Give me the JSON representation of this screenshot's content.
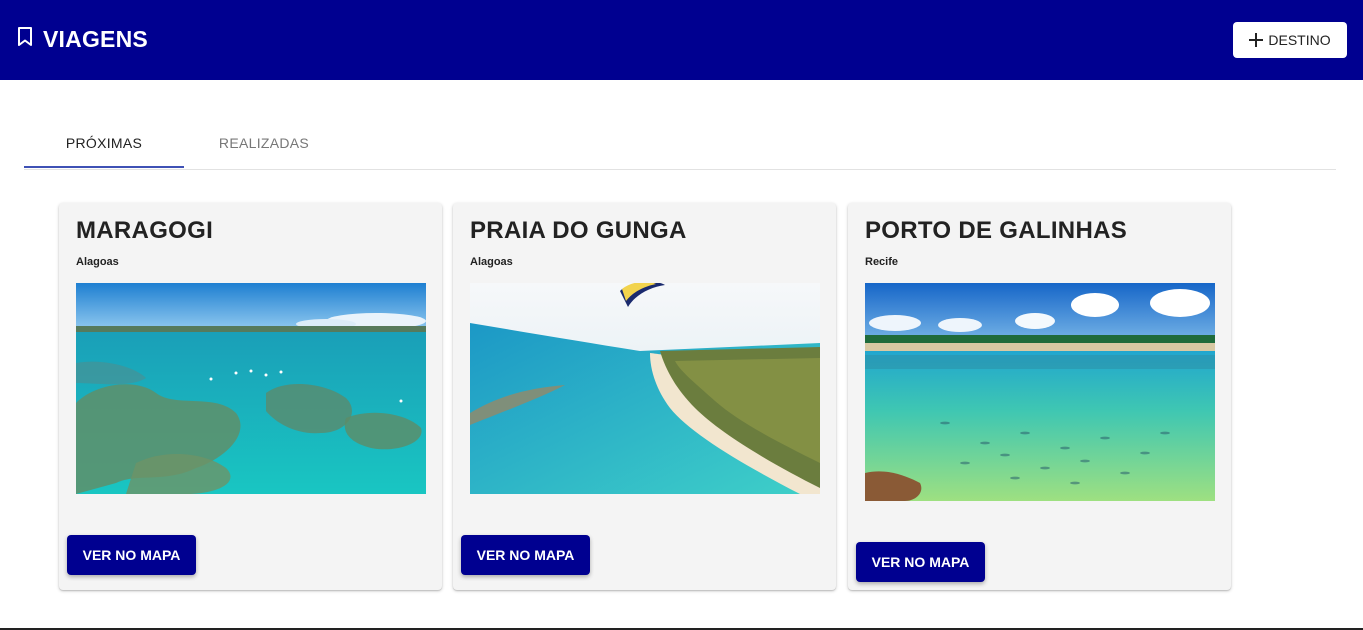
{
  "app": {
    "title": "VIAGENS",
    "icon": "bookmark-icon"
  },
  "header": {
    "add_button_label": "DESTINO",
    "add_icon": "plus-icon"
  },
  "tabs": [
    {
      "label": "PRÓXIMAS",
      "active": true
    },
    {
      "label": "REALIZADAS",
      "active": false
    }
  ],
  "cards": [
    {
      "title": "MARAGOGI",
      "subtitle": "Alagoas",
      "button_label": "VER NO MAPA"
    },
    {
      "title": "PRAIA DO GUNGA",
      "subtitle": "Alagoas",
      "button_label": "VER NO MAPA"
    },
    {
      "title": "PORTO DE GALINHAS",
      "subtitle": "Recife",
      "button_label": "VER NO MAPA"
    }
  ],
  "colors": {
    "primary": "#000090",
    "tab_indicator": "#3f51b5",
    "card_bg": "#f4f4f4"
  }
}
